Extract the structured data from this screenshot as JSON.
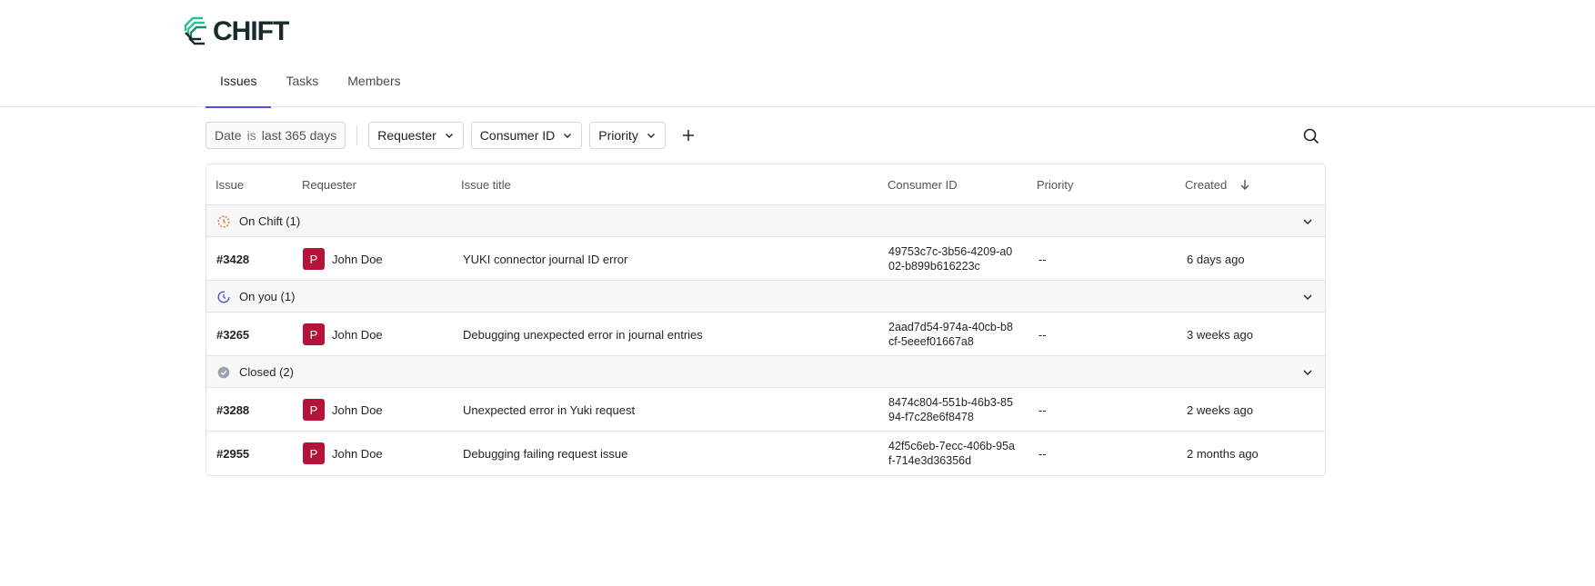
{
  "app": {
    "logo_text": "CHIFT",
    "brand_colors": {
      "logo_green": "#2bbf94",
      "logo_dark": "#172a2c",
      "accent": "#4f55d6",
      "avatar": "#b5123a"
    }
  },
  "tabs": [
    {
      "label": "Issues",
      "active": true
    },
    {
      "label": "Tasks",
      "active": false
    },
    {
      "label": "Members",
      "active": false
    }
  ],
  "filters": {
    "date": {
      "field": "Date",
      "operator": "is",
      "value": "last 365 days"
    },
    "requester": "Requester",
    "consumer_id": "Consumer ID",
    "priority": "Priority",
    "add_icon": "plus-icon",
    "search_icon": "search-icon"
  },
  "table": {
    "columns": {
      "issue": "Issue",
      "requester": "Requester",
      "title": "Issue title",
      "consumer_id": "Consumer ID",
      "priority": "Priority",
      "created": "Created"
    },
    "groups": [
      {
        "label": "On Chift (1)",
        "icon": "clock-dotted-icon",
        "rows": [
          {
            "id": "#3428",
            "avatar": "P",
            "requester": "John Doe",
            "title": "YUKI connector journal ID error",
            "consumer_id": "49753c7c-3b56-4209-a002-b899b616223c",
            "priority": "--",
            "created": "6 days ago"
          }
        ]
      },
      {
        "label": "On you (1)",
        "icon": "clock-progress-icon",
        "rows": [
          {
            "id": "#3265",
            "avatar": "P",
            "requester": "John Doe",
            "title": "Debugging unexpected error in journal entries",
            "consumer_id": "2aad7d54-974a-40cb-b8cf-5eeef01667a8",
            "priority": "--",
            "created": "3 weeks ago"
          }
        ]
      },
      {
        "label": "Closed (2)",
        "icon": "check-circle-icon",
        "rows": [
          {
            "id": "#3288",
            "avatar": "P",
            "requester": "John Doe",
            "title": "Unexpected error in Yuki request",
            "consumer_id": "8474c804-551b-46b3-8594-f7c28e6f8478",
            "priority": "--",
            "created": "2 weeks ago"
          },
          {
            "id": "#2955",
            "avatar": "P",
            "requester": "John Doe",
            "title": "Debugging failing request issue",
            "consumer_id": "42f5c6eb-7ecc-406b-95af-714e3d36356d",
            "priority": "--",
            "created": "2 months ago"
          }
        ]
      }
    ]
  }
}
